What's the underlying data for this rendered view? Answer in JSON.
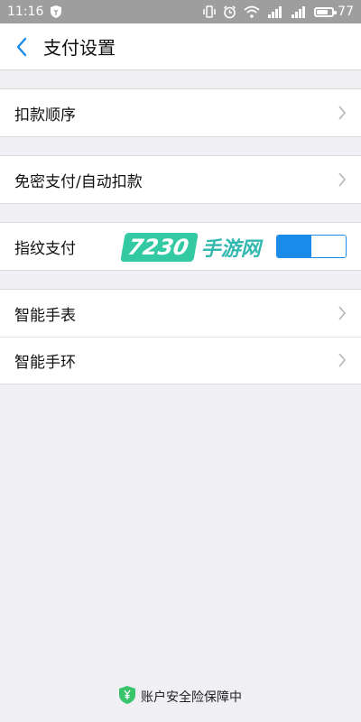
{
  "status_bar": {
    "time": "11:16",
    "battery_percent": "77",
    "battery_level": 0.77
  },
  "nav": {
    "title": "支付设置"
  },
  "groups": [
    {
      "items": [
        {
          "label": "扣款顺序"
        }
      ]
    },
    {
      "items": [
        {
          "label": "免密支付/自动扣款"
        }
      ]
    },
    {
      "items": [
        {
          "label": "指纹支付",
          "toggle_on": true
        }
      ]
    },
    {
      "items": [
        {
          "label": "智能手表"
        },
        {
          "label": "智能手环"
        }
      ]
    }
  ],
  "watermark": {
    "number": "7230",
    "text": "手游网"
  },
  "footer": {
    "text": "账户安全险保障中"
  },
  "colors": {
    "accent": "#1a8be8",
    "status_bar": "#9e9e9e",
    "background": "#efeff4",
    "shield": "#39c46b"
  }
}
